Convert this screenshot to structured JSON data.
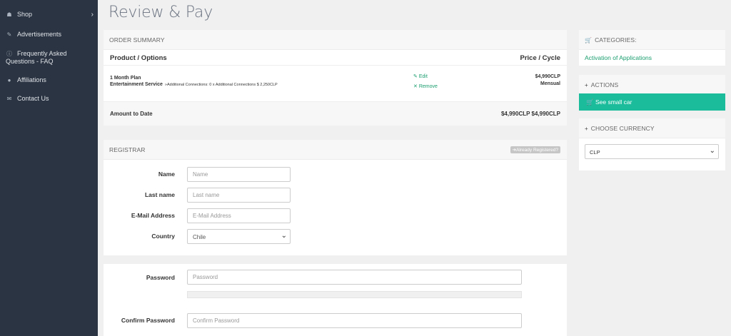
{
  "sidebar": {
    "items": [
      {
        "label": "Shop",
        "icon": "shop-icon"
      },
      {
        "label": "Advertisements",
        "icon": "megaphone-icon"
      },
      {
        "label": "Frequently Asked Questions - FAQ",
        "icon": "info-icon"
      },
      {
        "label": "Affiliations",
        "icon": "users-icon"
      },
      {
        "label": "Contact Us",
        "icon": "envelope-icon"
      }
    ]
  },
  "page": {
    "title": "Review & Pay"
  },
  "order_summary": {
    "header": "ORDER SUMMARY",
    "col_product": "Product / Options",
    "col_price": "Price / Cycle",
    "item": {
      "name": "1 Month Plan",
      "service": "Entertainment Service",
      "connections": "»Additional Connections: 0 x Additional Connections $ 2,250CLP",
      "edit": "Edit",
      "remove": "Remove",
      "price": "$4,990CLP",
      "cycle": "Mensual"
    },
    "total_label": "Amount to Date",
    "total_value": "$4,990CLP $4,990CLP"
  },
  "registrar": {
    "header": "REGISTRAR",
    "already": "Already Registered?",
    "fields": [
      {
        "label": "Name",
        "placeholder": "Name"
      },
      {
        "label": "Last name",
        "placeholder": "Last name"
      },
      {
        "label": "E-Mail Address",
        "placeholder": "E-Mail Address"
      }
    ],
    "country_label": "Country",
    "country_value": "Chile"
  },
  "password": {
    "label": "Password",
    "placeholder": "Password",
    "confirm_label": "Confirm Password",
    "confirm_placeholder": "Confirm Password"
  },
  "categories": {
    "header": "CATEGORIES:",
    "link": "Activation of Applications"
  },
  "actions": {
    "header": "ACTIONS",
    "button": "See small car"
  },
  "currency": {
    "header": "CHOOSE CURRENCY",
    "value": "CLP"
  },
  "colors": {
    "accent": "#1abc9c",
    "sidebar": "#2b3442",
    "link": "#1a9e6f"
  }
}
